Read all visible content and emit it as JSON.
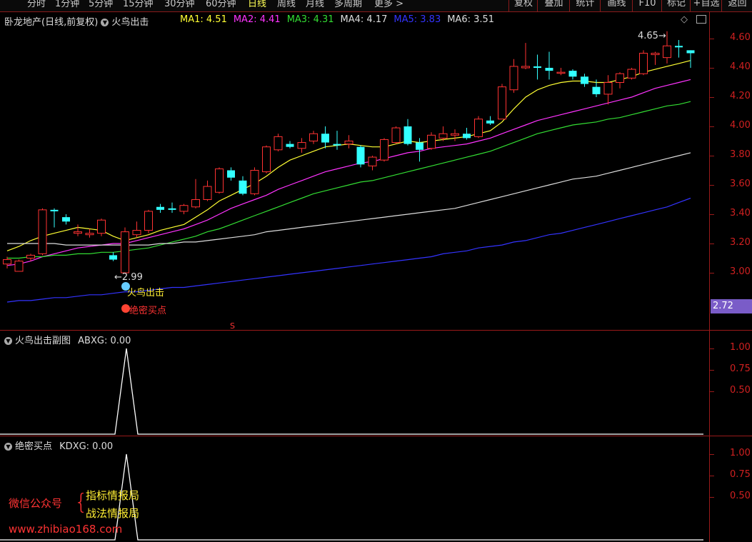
{
  "toolbar": {
    "tabs": [
      "分时",
      "1分钟",
      "5分钟",
      "15分钟",
      "30分钟",
      "60分钟",
      "日线",
      "周线",
      "月线",
      "多周期",
      "更多"
    ],
    "active_tab": "日线",
    "right_buttons": [
      "复权",
      "叠加",
      "统计",
      "画线",
      "F10",
      "标记",
      "+自选",
      "返回"
    ]
  },
  "main_panel": {
    "title": "卧龙地产(日线,前复权)",
    "indicator": "火鸟出击",
    "ma_labels": [
      {
        "text": "MA1: 4.51",
        "color": "#ffff33"
      },
      {
        "text": "MA2: 4.41",
        "color": "#ff33ff"
      },
      {
        "text": "MA3: 4.31",
        "color": "#33dd33"
      },
      {
        "text": "MA4: 4.17",
        "color": "#dddddd"
      },
      {
        "text": "MA5: 3.83",
        "color": "#3333ff"
      },
      {
        "text": "MA6: 3.51",
        "color": "#dddddd"
      }
    ],
    "y_ticks": [
      "4.60",
      "4.40",
      "4.20",
      "4.00",
      "3.80",
      "3.60",
      "3.40",
      "3.20",
      "3.00"
    ],
    "last_price": "2.72",
    "high_note": "4.65",
    "low_note": "2.99",
    "signal_fire": "火鸟出击",
    "signal_buy": "绝密买点",
    "s_mark": "S"
  },
  "sub1": {
    "title": "火鸟出击副图",
    "value_label": "ABXG: 0.00",
    "y_ticks": [
      "1.00",
      "0.75",
      "0.50"
    ]
  },
  "sub2": {
    "title": "绝密买点",
    "value_label": "KDXG: 0.00",
    "y_ticks": [
      "1.00",
      "0.75",
      "0.50"
    ]
  },
  "watermark": {
    "wechat_label": "微信公众号",
    "brace": "{",
    "line1": "指标情报局",
    "line2": "战法情报局",
    "url": "www.zhibiao168.com"
  },
  "colors": {
    "up": "#ff3232",
    "down": "#33ffff",
    "grid_red": "#9a1a1a"
  },
  "chart_data": {
    "type": "candlestick",
    "y_range": [
      2.85,
      4.68
    ],
    "candles": [
      {
        "o": 3.06,
        "h": 3.11,
        "l": 3.03,
        "c": 3.09
      },
      {
        "o": 3.01,
        "h": 3.09,
        "l": 3.01,
        "c": 3.08
      },
      {
        "o": 3.1,
        "h": 3.13,
        "l": 3.08,
        "c": 3.12
      },
      {
        "o": 3.13,
        "h": 3.44,
        "l": 3.12,
        "c": 3.43
      },
      {
        "o": 3.43,
        "h": 3.44,
        "l": 3.31,
        "c": 3.42
      },
      {
        "o": 3.38,
        "h": 3.4,
        "l": 3.33,
        "c": 3.35
      },
      {
        "o": 3.27,
        "h": 3.33,
        "l": 3.25,
        "c": 3.28
      },
      {
        "o": 3.26,
        "h": 3.3,
        "l": 3.24,
        "c": 3.27
      },
      {
        "o": 3.27,
        "h": 3.37,
        "l": 3.25,
        "c": 3.36
      },
      {
        "o": 3.12,
        "h": 3.14,
        "l": 3.08,
        "c": 3.09
      },
      {
        "o": 3.0,
        "h": 3.31,
        "l": 3.0,
        "c": 3.28
      },
      {
        "o": 3.26,
        "h": 3.35,
        "l": 3.24,
        "c": 3.29
      },
      {
        "o": 3.29,
        "h": 3.43,
        "l": 3.27,
        "c": 3.42
      },
      {
        "o": 3.45,
        "h": 3.47,
        "l": 3.41,
        "c": 3.43
      },
      {
        "o": 3.44,
        "h": 3.48,
        "l": 3.41,
        "c": 3.43
      },
      {
        "o": 3.42,
        "h": 3.47,
        "l": 3.4,
        "c": 3.46
      },
      {
        "o": 3.45,
        "h": 3.64,
        "l": 3.44,
        "c": 3.5
      },
      {
        "o": 3.5,
        "h": 3.63,
        "l": 3.49,
        "c": 3.59
      },
      {
        "o": 3.55,
        "h": 3.72,
        "l": 3.54,
        "c": 3.71
      },
      {
        "o": 3.7,
        "h": 3.72,
        "l": 3.63,
        "c": 3.65
      },
      {
        "o": 3.63,
        "h": 3.66,
        "l": 3.53,
        "c": 3.54
      },
      {
        "o": 3.54,
        "h": 3.72,
        "l": 3.53,
        "c": 3.7
      },
      {
        "o": 3.69,
        "h": 3.87,
        "l": 3.68,
        "c": 3.86
      },
      {
        "o": 3.84,
        "h": 3.95,
        "l": 3.83,
        "c": 3.93
      },
      {
        "o": 3.88,
        "h": 3.9,
        "l": 3.85,
        "c": 3.86
      },
      {
        "o": 3.85,
        "h": 3.92,
        "l": 3.82,
        "c": 3.89
      },
      {
        "o": 3.9,
        "h": 3.97,
        "l": 3.88,
        "c": 3.95
      },
      {
        "o": 3.95,
        "h": 4.0,
        "l": 3.85,
        "c": 3.89
      },
      {
        "o": 3.88,
        "h": 3.97,
        "l": 3.84,
        "c": 3.87
      },
      {
        "o": 3.88,
        "h": 3.94,
        "l": 3.85,
        "c": 3.9
      },
      {
        "o": 3.86,
        "h": 3.87,
        "l": 3.72,
        "c": 3.74
      },
      {
        "o": 3.73,
        "h": 3.8,
        "l": 3.7,
        "c": 3.79
      },
      {
        "o": 3.77,
        "h": 3.92,
        "l": 3.76,
        "c": 3.91
      },
      {
        "o": 3.89,
        "h": 4.0,
        "l": 3.88,
        "c": 3.99
      },
      {
        "o": 4.0,
        "h": 4.05,
        "l": 3.87,
        "c": 3.88
      },
      {
        "o": 3.89,
        "h": 3.92,
        "l": 3.76,
        "c": 3.84
      },
      {
        "o": 3.85,
        "h": 3.96,
        "l": 3.84,
        "c": 3.94
      },
      {
        "o": 3.92,
        "h": 4.0,
        "l": 3.9,
        "c": 3.95
      },
      {
        "o": 3.94,
        "h": 3.98,
        "l": 3.9,
        "c": 3.95
      },
      {
        "o": 3.95,
        "h": 3.99,
        "l": 3.91,
        "c": 3.92
      },
      {
        "o": 3.93,
        "h": 4.07,
        "l": 3.92,
        "c": 4.05
      },
      {
        "o": 4.04,
        "h": 4.07,
        "l": 4.01,
        "c": 4.02
      },
      {
        "o": 4.05,
        "h": 4.29,
        "l": 4.05,
        "c": 4.27
      },
      {
        "o": 4.25,
        "h": 4.46,
        "l": 4.23,
        "c": 4.41
      },
      {
        "o": 4.4,
        "h": 4.57,
        "l": 4.39,
        "c": 4.41
      },
      {
        "o": 4.41,
        "h": 4.49,
        "l": 4.32,
        "c": 4.4
      },
      {
        "o": 4.4,
        "h": 4.51,
        "l": 4.32,
        "c": 4.38
      },
      {
        "o": 4.37,
        "h": 4.4,
        "l": 4.35,
        "c": 4.37
      },
      {
        "o": 4.38,
        "h": 4.39,
        "l": 4.32,
        "c": 4.34
      },
      {
        "o": 4.34,
        "h": 4.36,
        "l": 4.27,
        "c": 4.29
      },
      {
        "o": 4.27,
        "h": 4.32,
        "l": 4.2,
        "c": 4.22
      },
      {
        "o": 4.22,
        "h": 4.35,
        "l": 4.15,
        "c": 4.3
      },
      {
        "o": 4.3,
        "h": 4.37,
        "l": 4.26,
        "c": 4.36
      },
      {
        "o": 4.33,
        "h": 4.4,
        "l": 4.32,
        "c": 4.39
      },
      {
        "o": 4.36,
        "h": 4.52,
        "l": 4.35,
        "c": 4.5
      },
      {
        "o": 4.49,
        "h": 4.51,
        "l": 4.42,
        "c": 4.5
      },
      {
        "o": 4.47,
        "h": 4.65,
        "l": 4.43,
        "c": 4.55
      },
      {
        "o": 4.55,
        "h": 4.59,
        "l": 4.47,
        "c": 4.54
      },
      {
        "o": 4.52,
        "h": 4.52,
        "l": 4.4,
        "c": 4.5
      }
    ],
    "ma_series": [
      {
        "name": "MA1",
        "color": "#ffff33",
        "values": [
          3.15,
          3.18,
          3.22,
          3.25,
          3.27,
          3.29,
          3.31,
          3.3,
          3.29,
          3.25,
          3.22,
          3.24,
          3.26,
          3.29,
          3.31,
          3.33,
          3.38,
          3.43,
          3.49,
          3.53,
          3.57,
          3.61,
          3.66,
          3.72,
          3.77,
          3.8,
          3.83,
          3.86,
          3.87,
          3.88,
          3.87,
          3.86,
          3.86,
          3.88,
          3.9,
          3.89,
          3.9,
          3.91,
          3.92,
          3.93,
          3.95,
          3.97,
          4.03,
          4.12,
          4.2,
          4.25,
          4.28,
          4.3,
          4.31,
          4.31,
          4.3,
          4.3,
          4.32,
          4.34,
          4.37,
          4.39,
          4.41,
          4.43,
          4.45
        ]
      },
      {
        "name": "MA2",
        "color": "#ff33ff",
        "values": [
          3.05,
          3.06,
          3.08,
          3.11,
          3.13,
          3.15,
          3.17,
          3.18,
          3.19,
          3.2,
          3.2,
          3.22,
          3.24,
          3.26,
          3.28,
          3.3,
          3.33,
          3.36,
          3.4,
          3.44,
          3.47,
          3.5,
          3.53,
          3.57,
          3.6,
          3.63,
          3.66,
          3.69,
          3.71,
          3.73,
          3.75,
          3.76,
          3.78,
          3.8,
          3.82,
          3.83,
          3.85,
          3.86,
          3.87,
          3.88,
          3.9,
          3.92,
          3.95,
          3.98,
          4.01,
          4.04,
          4.06,
          4.08,
          4.1,
          4.12,
          4.14,
          4.16,
          4.18,
          4.2,
          4.23,
          4.26,
          4.28,
          4.3,
          4.32
        ]
      },
      {
        "name": "MA3",
        "color": "#33dd33",
        "values": [
          3.1,
          3.1,
          3.11,
          3.11,
          3.12,
          3.12,
          3.13,
          3.13,
          3.14,
          3.14,
          3.15,
          3.16,
          3.17,
          3.19,
          3.21,
          3.23,
          3.25,
          3.28,
          3.3,
          3.33,
          3.36,
          3.39,
          3.42,
          3.45,
          3.48,
          3.51,
          3.54,
          3.56,
          3.58,
          3.6,
          3.62,
          3.63,
          3.65,
          3.67,
          3.69,
          3.71,
          3.73,
          3.75,
          3.77,
          3.79,
          3.81,
          3.83,
          3.86,
          3.89,
          3.92,
          3.95,
          3.97,
          3.99,
          4.01,
          4.02,
          4.03,
          4.05,
          4.06,
          4.08,
          4.1,
          4.12,
          4.14,
          4.15,
          4.17
        ]
      },
      {
        "name": "MA4",
        "color": "#dddddd",
        "values": [
          3.2,
          3.2,
          3.2,
          3.2,
          3.2,
          3.19,
          3.19,
          3.19,
          3.19,
          3.19,
          3.19,
          3.19,
          3.19,
          3.2,
          3.2,
          3.21,
          3.21,
          3.22,
          3.23,
          3.24,
          3.25,
          3.26,
          3.28,
          3.29,
          3.3,
          3.31,
          3.32,
          3.33,
          3.34,
          3.35,
          3.36,
          3.37,
          3.38,
          3.39,
          3.4,
          3.41,
          3.42,
          3.43,
          3.44,
          3.46,
          3.48,
          3.5,
          3.52,
          3.54,
          3.56,
          3.58,
          3.6,
          3.62,
          3.64,
          3.65,
          3.66,
          3.68,
          3.7,
          3.72,
          3.74,
          3.76,
          3.78,
          3.8,
          3.82
        ]
      },
      {
        "name": "MA5",
        "color": "#3333ff",
        "values": [
          2.8,
          2.81,
          2.81,
          2.82,
          2.83,
          2.83,
          2.84,
          2.85,
          2.85,
          2.86,
          2.87,
          2.87,
          2.88,
          2.89,
          2.9,
          2.9,
          2.91,
          2.92,
          2.93,
          2.94,
          2.95,
          2.96,
          2.97,
          2.98,
          2.99,
          3.0,
          3.01,
          3.02,
          3.03,
          3.04,
          3.05,
          3.06,
          3.07,
          3.08,
          3.09,
          3.1,
          3.11,
          3.13,
          3.14,
          3.15,
          3.17,
          3.18,
          3.19,
          3.21,
          3.22,
          3.24,
          3.26,
          3.27,
          3.29,
          3.31,
          3.33,
          3.35,
          3.37,
          3.39,
          3.41,
          3.43,
          3.45,
          3.48,
          3.51
        ]
      }
    ],
    "sub1_values_note": "single spike to 1.00 near bar 10, otherwise 0",
    "sub1_spike_index": 10,
    "sub2_spike_index": 10
  }
}
